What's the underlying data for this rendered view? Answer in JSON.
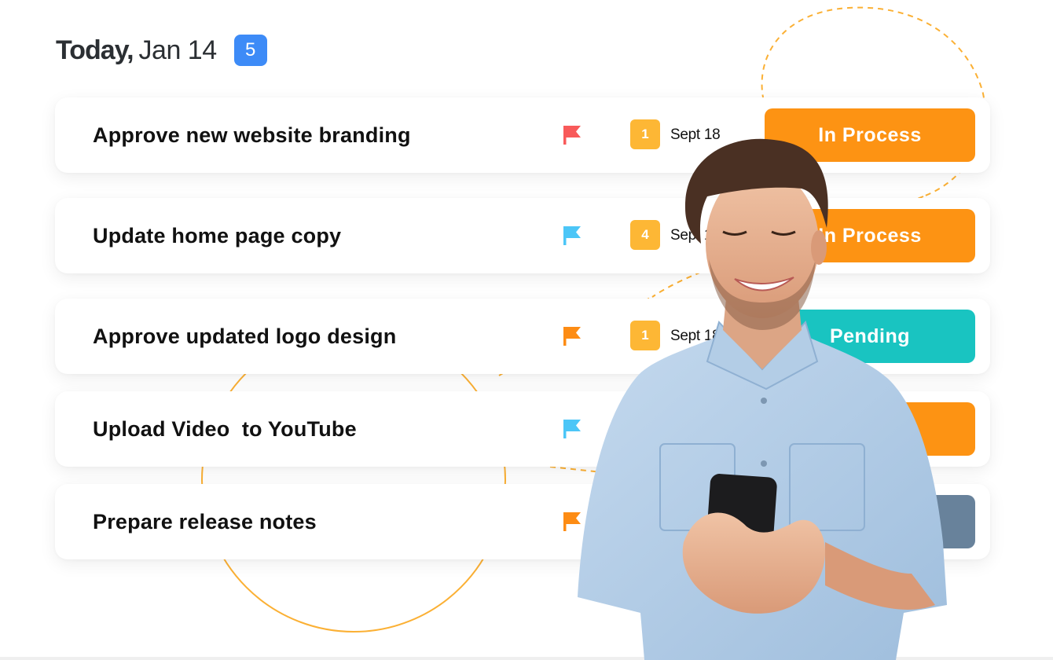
{
  "header": {
    "today_label": "Today,",
    "date": "Jan 14",
    "task_count": "5",
    "count_badge_color": "#3d8bf7"
  },
  "tasks": [
    {
      "title": "Approve new website branding",
      "flag_icon": "flag-icon",
      "flag_color": "#f85a5a",
      "priority": "1",
      "due": "Sept 18",
      "status": "In Process",
      "status_color": "#fd9313"
    },
    {
      "title": "Update home page copy",
      "flag_icon": "flag-icon",
      "flag_color": "#4cc6f7",
      "priority": "4",
      "due": "Sept 18",
      "status": "In Process",
      "status_color": "#fd9313"
    },
    {
      "title": "Approve updated logo design",
      "flag_icon": "flag-icon",
      "flag_color": "#fd8c14",
      "priority": "1",
      "due": "Sept 18",
      "status": "Pending",
      "status_color": "#19c4c1"
    },
    {
      "title": "Upload Video  to YouTube",
      "flag_icon": "flag-icon",
      "flag_color": "#4cc6f7",
      "priority": "",
      "due": "",
      "status": "",
      "status_color": "#fd9313"
    },
    {
      "title": "Prepare release notes",
      "flag_icon": "flag-icon",
      "flag_color": "#fd8c14",
      "priority": "",
      "due": "",
      "status": "",
      "status_color": "#68829b"
    }
  ],
  "colors": {
    "priority_badge": "#fdb735",
    "decor_line": "#fbb034"
  },
  "illustration": {
    "subject": "smiling man in denim shirt holding smartphone"
  }
}
